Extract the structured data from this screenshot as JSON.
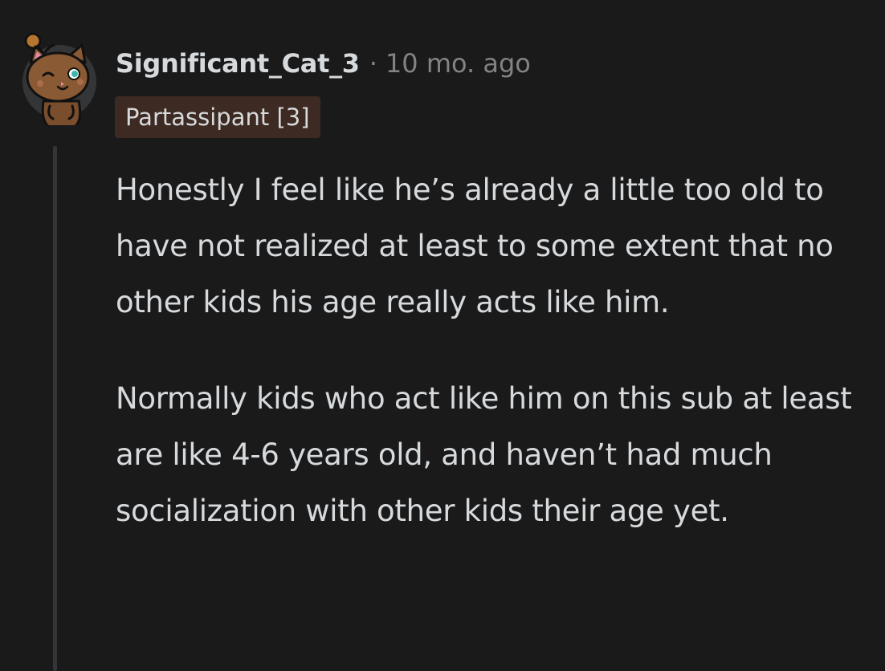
{
  "comment": {
    "username": "Significant_Cat_3",
    "separator": "·",
    "timestamp": "10 mo. ago",
    "flair": "Partassipant [3]",
    "paragraphs": [
      "Honestly I feel like he’s already a little too old to have not realized at least to some extent that no other kids his age really acts like him.",
      "Normally kids who act like him on this sub at least are like 4-6 years old, and haven’t had much socialization with other kids their age yet."
    ],
    "avatar_icon": "cat-snoo-avatar-icon"
  },
  "colors": {
    "background": "#1a1a1b",
    "text": "#d7dadc",
    "meta": "#818384",
    "flair_background": "#3d2a22",
    "thread_line": "#343536"
  }
}
